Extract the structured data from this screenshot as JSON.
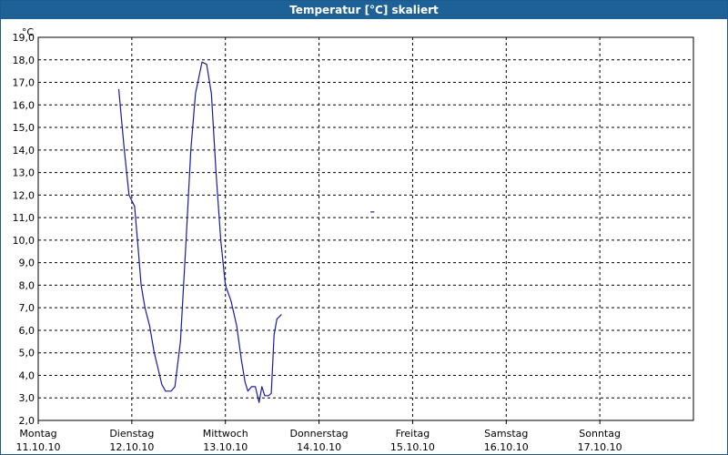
{
  "window": {
    "title": "Temperatur [°C] skaliert"
  },
  "chart_data": {
    "type": "line",
    "title": "Temperatur [°C] skaliert",
    "ylabel": "°C",
    "xlabel": "",
    "ylim": [
      2,
      19
    ],
    "y_ticks": [
      "2,0",
      "3,0",
      "4,0",
      "5,0",
      "6,0",
      "7,0",
      "8,0",
      "9,0",
      "10,0",
      "11,0",
      "12,0",
      "13,0",
      "14,0",
      "15,0",
      "16,0",
      "17,0",
      "18,0",
      "19,0"
    ],
    "x_range_days": [
      0,
      7
    ],
    "x_ticks": [
      {
        "day": "Montag",
        "date": "11.10.10"
      },
      {
        "day": "Dienstag",
        "date": "12.10.10"
      },
      {
        "day": "Mittwoch",
        "date": "13.10.10"
      },
      {
        "day": "Donnerstag",
        "date": "14.10.10"
      },
      {
        "day": "Freitag",
        "date": "15.10.10"
      },
      {
        "day": "Samstag",
        "date": "16.10.10"
      },
      {
        "day": "Sonntag",
        "date": "17.10.10"
      }
    ],
    "grid": true,
    "line_color": "#1a1aa8",
    "series": [
      {
        "points": [
          [
            0.86,
            16.7
          ],
          [
            0.92,
            14.0
          ],
          [
            0.97,
            12.0
          ],
          [
            1.03,
            11.5
          ],
          [
            1.07,
            9.5
          ],
          [
            1.1,
            8.0
          ],
          [
            1.14,
            7.0
          ],
          [
            1.19,
            6.2
          ],
          [
            1.24,
            5.0
          ],
          [
            1.28,
            4.3
          ],
          [
            1.32,
            3.6
          ],
          [
            1.36,
            3.3
          ],
          [
            1.42,
            3.3
          ],
          [
            1.46,
            3.5
          ],
          [
            1.52,
            5.5
          ],
          [
            1.58,
            10.0
          ],
          [
            1.63,
            14.0
          ],
          [
            1.68,
            16.5
          ],
          [
            1.75,
            17.9
          ],
          [
            1.8,
            17.8
          ],
          [
            1.85,
            16.5
          ],
          [
            1.9,
            13.0
          ],
          [
            1.95,
            10.0
          ],
          [
            2.0,
            8.0
          ],
          [
            2.06,
            7.3
          ],
          [
            2.12,
            6.2
          ],
          [
            2.17,
            4.7
          ],
          [
            2.21,
            3.7
          ],
          [
            2.24,
            3.3
          ],
          [
            2.28,
            3.5
          ],
          [
            2.32,
            3.5
          ],
          [
            2.36,
            2.8
          ],
          [
            2.39,
            3.5
          ],
          [
            2.42,
            3.1
          ],
          [
            2.46,
            3.1
          ],
          [
            2.49,
            3.2
          ],
          [
            2.52,
            5.8
          ],
          [
            2.55,
            6.5
          ],
          [
            2.6,
            6.7
          ]
        ]
      },
      {
        "points": [
          [
            3.55,
            11.25
          ],
          [
            3.59,
            11.25
          ]
        ]
      }
    ]
  }
}
